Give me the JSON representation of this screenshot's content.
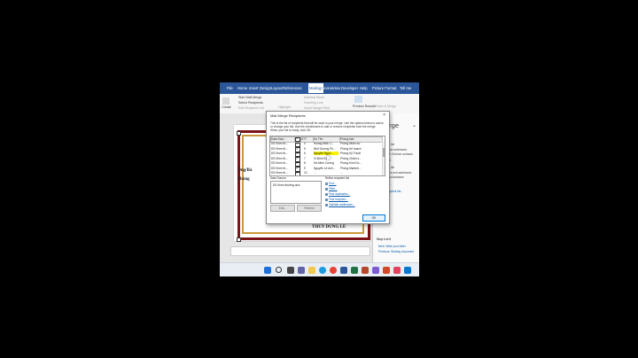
{
  "ribbon": {
    "tabs": [
      "File",
      "Home",
      "Insert",
      "Design",
      "Layout",
      "References",
      "Mailings",
      "Review",
      "View",
      "Developer",
      "Help",
      "Picture Format",
      "Tell me"
    ],
    "active_tab": "Mailings",
    "buttons": {
      "create": "Create",
      "start_mail_merge": "Start Mail Merge",
      "select_recipients": "Select Recipients",
      "edit_recipient_list": "Edit Recipient List",
      "highlight": "Highlight",
      "address_block": "Address Block",
      "greeting_line": "Greeting Line",
      "insert_merge_field": "Insert Merge Field",
      "preview_results": "Preview Results",
      "finish_merge": "Finish & Merge"
    }
  },
  "document": {
    "line1": "Ông/Bà",
    "line2": "Phòng",
    "signature": "THỦY DUNG LÊ"
  },
  "dialog": {
    "title": "Mail Merge Recipients",
    "close": "×",
    "description": "This is the list of recipients that will be used in your merge. Use the options below to add to or change your list. Use the checkboxes to add or remove recipients from the merge. When your list is ready, click OK.",
    "columns": [
      "Data Sour...",
      "",
      "STT",
      "Họ Tên",
      "Phòng ban"
    ],
    "rows": [
      {
        "source": "DS Khen th...",
        "stt": "4",
        "name": "Hoàng Minh C...",
        "dept": "Phòng Nhân sự"
      },
      {
        "source": "DS Khen th...",
        "stt": "5",
        "name": "Nhữ Dương Ph...",
        "dept": "Phòng Kế hoạch"
      },
      {
        "source": "DS Khen th...",
        "stt": "6",
        "name": "Nguyễn Ngọc...",
        "dept": "Phòng Kỹ Thuật"
      },
      {
        "source": "DS Khen th...",
        "stt": "7",
        "name": "Vi Minh Đức",
        "dept": "Phòng Chăm s..."
      },
      {
        "source": "DS Khen th...",
        "stt": "8",
        "name": "Hà Minh Cường",
        "dept": "Phòng Kinh Do..."
      },
      {
        "source": "DS Khen th...",
        "stt": "9",
        "name": "Nguyễn Lê Anh...",
        "dept": "Phòng Marketi..."
      },
      {
        "source": "DS Khen th...",
        "stt": "10",
        "name": "...",
        "dept": "..."
      }
    ],
    "data_source_label": "Data Source",
    "data_source_item": "DS Khen thưởng.xlsx",
    "refine_label": "Refine recipient list",
    "refine_links": [
      "Sort...",
      "Filter...",
      "Find duplicates...",
      "Find recipient...",
      "Validate addresses..."
    ],
    "edit_button": "Edit...",
    "refresh_button": "Refresh",
    "ok_button": "OK"
  },
  "pane": {
    "title": "l Merge",
    "lines": [
      "recipients",
      "an existing list",
      "e names and addresses",
      "Select from Outlook contacts",
      "e a new list",
      "an existing list",
      "g the names and addresses",
      "m a file or a database.",
      "Browse...",
      "Edit recipient list...",
      "Step 3 of 6",
      "Next: Write your letter",
      "Previous: Starting document"
    ]
  },
  "colors": {
    "ribbon_blue": "#2b579a",
    "frame_red": "#7a1416",
    "frame_gold": "#c99b3c",
    "link_blue": "#0a5cad",
    "highlight_yellow": "#f7f200"
  }
}
